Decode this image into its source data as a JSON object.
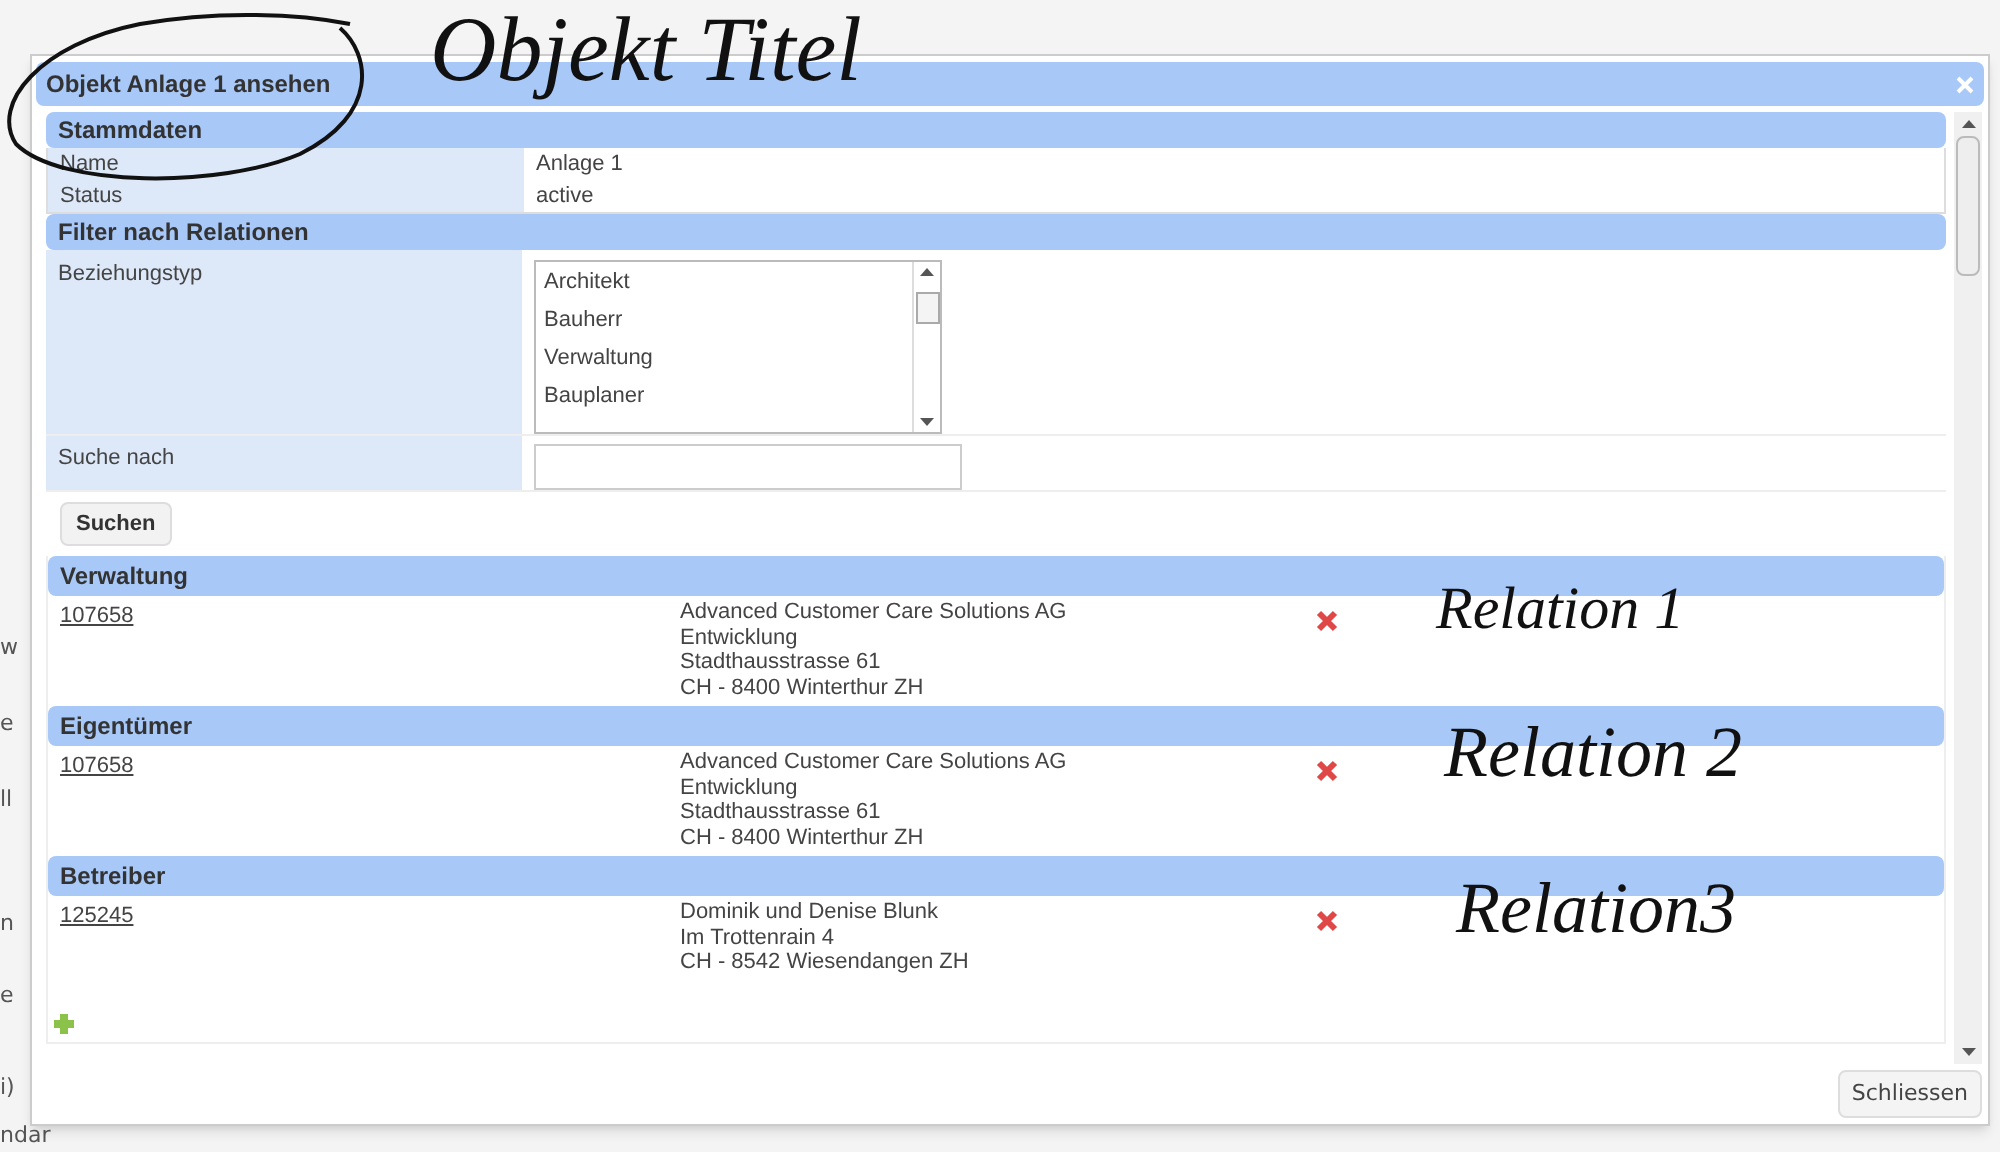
{
  "background_fragments": [
    "w",
    "e",
    "ll",
    "n",
    "e",
    "i)",
    "ndar"
  ],
  "dialog": {
    "title": "Objekt Anlage 1 ansehen"
  },
  "stammdaten": {
    "heading": "Stammdaten",
    "rows": [
      {
        "label": "Name",
        "value": "Anlage 1"
      },
      {
        "label": "Status",
        "value": "active"
      }
    ]
  },
  "filter": {
    "heading": "Filter nach Relationen",
    "relation_type": {
      "label": "Beziehungstyp",
      "options": [
        "Architekt",
        "Bauherr",
        "Verwaltung",
        "Bauplaner"
      ]
    },
    "search": {
      "label": "Suche nach"
    },
    "button": "Suchen"
  },
  "relations": [
    {
      "type": "Verwaltung",
      "id": "107658",
      "address": [
        "Advanced Customer Care Solutions AG",
        "Entwicklung",
        "Stadthausstrasse 61",
        "CH - 8400 Winterthur ZH"
      ]
    },
    {
      "type": "Eigentümer",
      "id": "107658",
      "address": [
        "Advanced Customer Care Solutions AG",
        "Entwicklung",
        "Stadthausstrasse 61",
        "CH - 8400 Winterthur ZH"
      ]
    },
    {
      "type": "Betreiber",
      "id": "125245",
      "address": [
        "Dominik und Denise Blunk",
        "Im Trottenrain 4",
        "CH - 8542 Wiesendangen ZH"
      ]
    }
  ],
  "close_button": "Schliessen",
  "annotations": [
    {
      "text": "Objekt Titel"
    },
    {
      "text": "Relation 1"
    },
    {
      "text": "Relation 2"
    },
    {
      "text": "Relation3"
    }
  ]
}
